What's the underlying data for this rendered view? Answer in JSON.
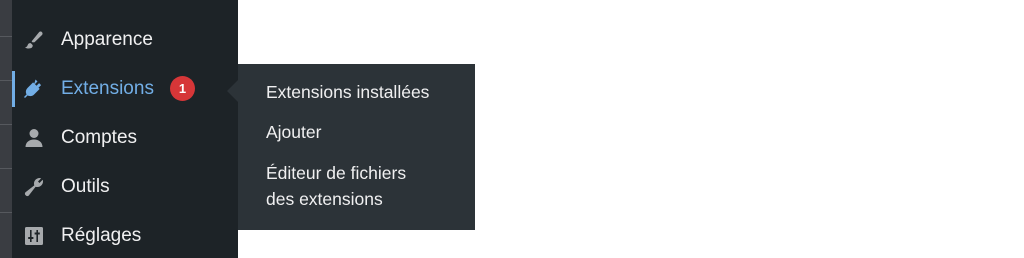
{
  "sidebar": {
    "items": [
      {
        "label": "Apparence",
        "icon": "paintbrush-icon"
      },
      {
        "label": "Extensions",
        "icon": "plugin-icon",
        "badge": "1",
        "active": true
      },
      {
        "label": "Comptes",
        "icon": "users-icon"
      },
      {
        "label": "Outils",
        "icon": "wrench-icon"
      },
      {
        "label": "Réglages",
        "icon": "sliders-icon"
      }
    ]
  },
  "flyout": {
    "items": [
      {
        "label": "Extensions installées"
      },
      {
        "label": "Ajouter"
      },
      {
        "label_line1": "Éditeur de fichiers",
        "label_line2": "des extensions"
      }
    ]
  },
  "colors": {
    "sidebar_bg": "#1d2327",
    "flyout_bg": "#2c3338",
    "active_text": "#72aee6",
    "badge_bg": "#d63638",
    "text": "#f0f0f1",
    "icon": "#a7aaad"
  }
}
